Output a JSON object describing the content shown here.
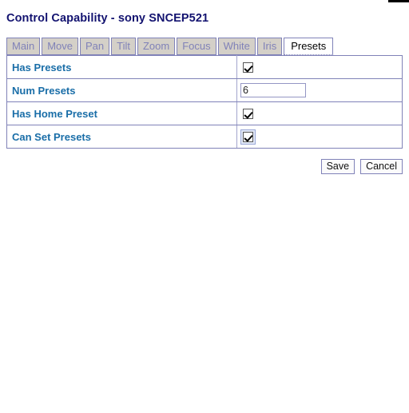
{
  "window": {
    "title": "Control Capability - sony SNCEP521"
  },
  "tabs": {
    "items": [
      {
        "label": "Main",
        "active": false
      },
      {
        "label": "Move",
        "active": false
      },
      {
        "label": "Pan",
        "active": false
      },
      {
        "label": "Tilt",
        "active": false
      },
      {
        "label": "Zoom",
        "active": false
      },
      {
        "label": "Focus",
        "active": false
      },
      {
        "label": "White",
        "active": false
      },
      {
        "label": "Iris",
        "active": false
      },
      {
        "label": "Presets",
        "active": true
      }
    ],
    "selected": "Presets"
  },
  "table": {
    "rows": [
      {
        "label": "Has Presets",
        "control": "checkbox",
        "checked": true,
        "focused": false
      },
      {
        "label": "Num Presets",
        "control": "text",
        "value": "6",
        "placeholder": ""
      },
      {
        "label": "Has Home Preset",
        "control": "checkbox",
        "checked": true,
        "focused": false
      },
      {
        "label": "Can Set Presets",
        "control": "checkbox",
        "checked": true,
        "focused": true
      }
    ]
  },
  "buttons": {
    "save_label": "Save",
    "cancel_label": "Cancel"
  },
  "colors": {
    "title_text": "#131370",
    "row_label_text": "#1a6ea8",
    "border": "#8082b8",
    "tab_inactive_bg": "#d4d0c8",
    "tab_inactive_text": "#8082b8",
    "tab_active_bg": "#ffffff",
    "focus_ring": "#9aa8d8",
    "page_bg": "#ffffff"
  }
}
